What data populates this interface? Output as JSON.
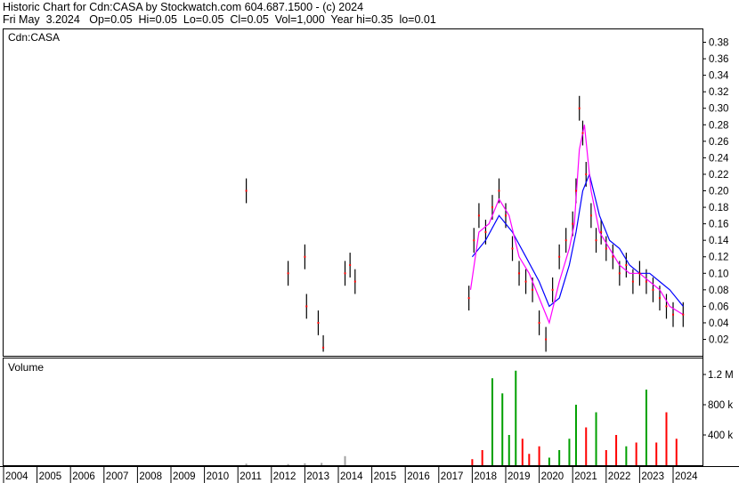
{
  "header": {
    "line1": "Historic Chart for Cdn:CASA by Stockwatch.com 604.687.1500 - (c) 2024",
    "line2": "Fri May  3.2024   Op=0.05  Hi=0.05  Lo=0.05  Cl=0.05  Vol=1,000  Year hi=0.35  lo=0.01"
  },
  "chart_data": {
    "type": "line",
    "price_panel_label": "Cdn:CASA",
    "volume_panel_label": "Volume",
    "x_labels": [
      "2004",
      "2005",
      "2006",
      "2007",
      "2008",
      "2009",
      "2010",
      "2011",
      "2012",
      "2013",
      "2014",
      "2015",
      "2016",
      "2017",
      "2018",
      "2019",
      "2020",
      "2021",
      "2022",
      "2023",
      "2024"
    ],
    "y_ticks": [
      "0.38",
      "0.36",
      "0.34",
      "0.32",
      "0.30",
      "0.28",
      "0.26",
      "0.24",
      "0.22",
      "0.20",
      "0.18",
      "0.16",
      "0.14",
      "0.12",
      "0.10",
      "0.08",
      "0.06",
      "0.04",
      "0.02"
    ],
    "y_range": [
      0.0,
      0.39
    ],
    "volume_ticks": [
      "1.2 M",
      "800 k",
      "400 k"
    ],
    "volume_range": [
      0,
      1400000
    ],
    "grid": false,
    "colors": {
      "price_bar": "#000000",
      "close_dot": "#ff0000",
      "ma_short": "#ff00ff",
      "ma_long": "#0000ff",
      "vol_up": "#00a000",
      "vol_down": "#ff0000",
      "vol_flat": "#a0a0a0"
    },
    "series": [
      {
        "name": "Close",
        "x": [
          2011.25,
          2012.5,
          2013.0,
          2013.05,
          2013.4,
          2013.55,
          2014.2,
          2014.35,
          2014.5,
          2017.9,
          2018.05,
          2018.2,
          2018.4,
          2018.6,
          2018.8,
          2019.0,
          2019.2,
          2019.4,
          2019.6,
          2019.8,
          2020.0,
          2020.2,
          2020.4,
          2020.6,
          2020.8,
          2021.0,
          2021.1,
          2021.2,
          2021.3,
          2021.4,
          2021.55,
          2021.7,
          2021.85,
          2022.0,
          2022.2,
          2022.4,
          2022.6,
          2022.8,
          2023.0,
          2023.2,
          2023.4,
          2023.6,
          2023.8,
          2024.0,
          2024.3
        ],
        "values": [
          0.2,
          0.1,
          0.12,
          0.06,
          0.04,
          0.01,
          0.1,
          0.11,
          0.09,
          0.07,
          0.14,
          0.17,
          0.15,
          0.18,
          0.2,
          0.17,
          0.13,
          0.1,
          0.09,
          0.08,
          0.04,
          0.02,
          0.08,
          0.12,
          0.14,
          0.16,
          0.2,
          0.3,
          0.27,
          0.22,
          0.17,
          0.14,
          0.15,
          0.13,
          0.12,
          0.1,
          0.11,
          0.09,
          0.1,
          0.09,
          0.08,
          0.07,
          0.06,
          0.05,
          0.05
        ]
      },
      {
        "name": "MA short",
        "x": [
          2017.95,
          2018.2,
          2018.5,
          2018.8,
          2019.1,
          2019.4,
          2019.7,
          2020.0,
          2020.3,
          2020.6,
          2020.9,
          2021.05,
          2021.2,
          2021.35,
          2021.55,
          2021.8,
          2022.1,
          2022.4,
          2022.7,
          2023.0,
          2023.3,
          2023.6,
          2023.9,
          2024.3
        ],
        "values": [
          0.08,
          0.15,
          0.16,
          0.19,
          0.17,
          0.12,
          0.1,
          0.07,
          0.04,
          0.09,
          0.13,
          0.16,
          0.25,
          0.28,
          0.2,
          0.15,
          0.13,
          0.11,
          0.1,
          0.1,
          0.09,
          0.08,
          0.06,
          0.05
        ]
      },
      {
        "name": "MA long",
        "x": [
          2018.0,
          2018.4,
          2018.8,
          2019.2,
          2019.6,
          2020.0,
          2020.3,
          2020.6,
          2020.9,
          2021.1,
          2021.3,
          2021.5,
          2021.8,
          2022.1,
          2022.4,
          2022.7,
          2023.0,
          2023.3,
          2023.6,
          2023.9,
          2024.3
        ],
        "values": [
          0.12,
          0.14,
          0.17,
          0.15,
          0.12,
          0.09,
          0.06,
          0.07,
          0.11,
          0.15,
          0.2,
          0.22,
          0.17,
          0.14,
          0.13,
          0.11,
          0.1,
          0.1,
          0.09,
          0.08,
          0.06
        ]
      }
    ],
    "volume": {
      "x": [
        2011.25,
        2012.5,
        2013.0,
        2013.5,
        2014.2,
        2018.0,
        2018.3,
        2018.6,
        2018.9,
        2019.1,
        2019.3,
        2019.5,
        2019.7,
        2020.0,
        2020.3,
        2020.6,
        2020.9,
        2021.1,
        2021.4,
        2021.7,
        2022.0,
        2022.3,
        2022.6,
        2022.9,
        2023.2,
        2023.5,
        2023.8,
        2024.1
      ],
      "values": [
        20000,
        15000,
        25000,
        30000,
        120000,
        80000,
        200000,
        1150000,
        950000,
        400000,
        1250000,
        350000,
        150000,
        250000,
        100000,
        200000,
        350000,
        800000,
        500000,
        700000,
        200000,
        400000,
        250000,
        300000,
        1000000,
        300000,
        700000,
        350000
      ],
      "direction": [
        "flat",
        "flat",
        "flat",
        "flat",
        "flat",
        "down",
        "down",
        "up",
        "up",
        "up",
        "up",
        "down",
        "down",
        "down",
        "up",
        "up",
        "up",
        "up",
        "down",
        "up",
        "down",
        "down",
        "up",
        "down",
        "up",
        "down",
        "down",
        "down"
      ]
    }
  }
}
